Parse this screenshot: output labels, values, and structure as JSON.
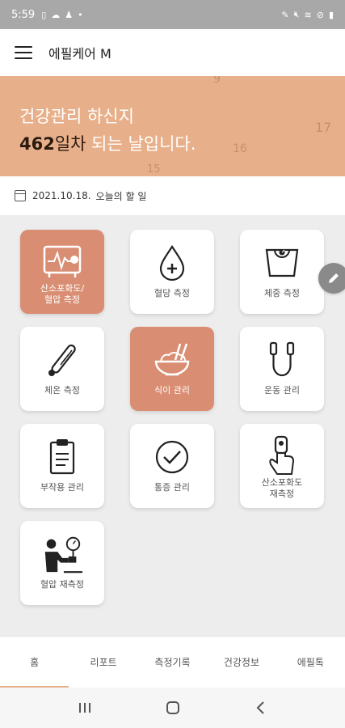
{
  "status_bar": {
    "time": "5:59"
  },
  "app_bar": {
    "title": "에필케어 M"
  },
  "banner": {
    "line1": "건강관리 하신지",
    "days": "462",
    "day_suffix": "일차",
    "rest": " 되는 날입니다.",
    "deco_numbers": [
      "9",
      "17",
      "16",
      "15"
    ]
  },
  "date_row": {
    "date": "2021.10.18.",
    "todo": "오늘의 할 일"
  },
  "tiles": [
    {
      "label": "산소포화도/\n혈압 측정",
      "icon": "oximeter-monitor-icon",
      "active": true
    },
    {
      "label": "혈당 측정",
      "icon": "blood-drop-icon",
      "active": false
    },
    {
      "label": "체중 측정",
      "icon": "scale-icon",
      "active": false
    },
    {
      "label": "체온 측정",
      "icon": "thermometer-icon",
      "active": false
    },
    {
      "label": "식이 관리",
      "icon": "rice-bowl-icon",
      "active": true
    },
    {
      "label": "운동 관리",
      "icon": "jump-rope-icon",
      "active": false
    },
    {
      "label": "부작용 관리",
      "icon": "clipboard-icon",
      "active": false
    },
    {
      "label": "통증 관리",
      "icon": "checkmark-icon",
      "active": false
    },
    {
      "label": "산소포화도\n재측정",
      "icon": "finger-oximeter-icon",
      "active": false
    },
    {
      "label": "혈압 재측정",
      "icon": "blood-pressure-icon",
      "active": false
    }
  ],
  "bottom_nav": [
    "홈",
    "리포트",
    "측정기록",
    "건강정보",
    "에필톡"
  ],
  "colors": {
    "accent": "#e8b08a",
    "tile_active": "#d98e73"
  }
}
